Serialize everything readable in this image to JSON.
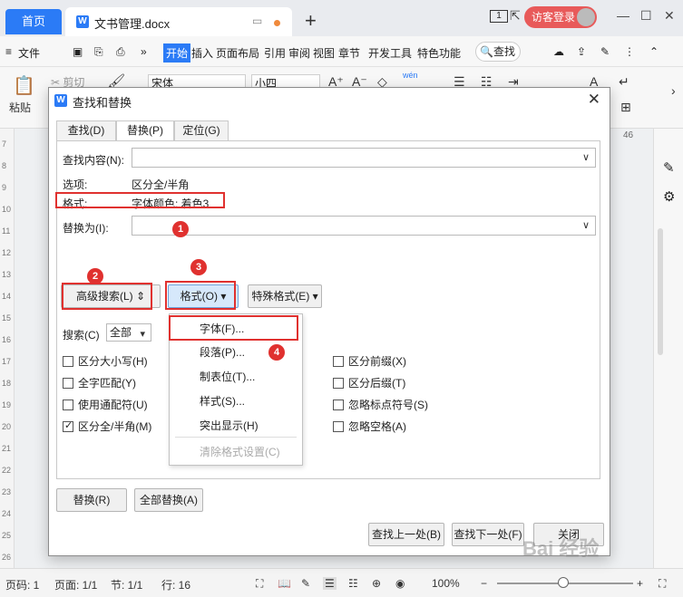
{
  "tabs": {
    "home": "首页",
    "doc": "文书管理.docx"
  },
  "titlebar": {
    "page_count": "1",
    "login": "访客登录"
  },
  "menu": {
    "file": "文件",
    "items": [
      "开始",
      "插入",
      "页面布局",
      "引用",
      "审阅",
      "视图",
      "章节",
      "开发工具",
      "特色功能"
    ],
    "search": "查找"
  },
  "ribbon": {
    "paste": "粘贴",
    "cut": "剪切",
    "font": "宋体",
    "size": "小四",
    "pinyin": "wén"
  },
  "ruler": {
    "right_num": "46",
    "left_nums": [
      "7",
      "8",
      "9",
      "10",
      "11",
      "12",
      "13",
      "14",
      "15",
      "16",
      "17",
      "18",
      "19",
      "20",
      "21",
      "22",
      "23",
      "24",
      "25",
      "26"
    ]
  },
  "dialog": {
    "title": "查找和替换",
    "tabs": [
      "查找(D)",
      "替换(P)",
      "定位(G)"
    ],
    "find_label": "查找内容(N):",
    "options_label": "选项:",
    "options_value": "区分全/半角",
    "format_label": "格式:",
    "format_value": "字体颜色: 着色3",
    "replace_label": "替换为(I):",
    "adv_search": "高级搜索(L)",
    "format_btn": "格式(O)",
    "special_btn": "特殊格式(E)",
    "search_label": "搜索(C)",
    "search_scope": "全部",
    "checks_left": [
      {
        "label": "区分大小写(H)",
        "checked": false
      },
      {
        "label": "全字匹配(Y)",
        "checked": false
      },
      {
        "label": "使用通配符(U)",
        "checked": false
      },
      {
        "label": "区分全/半角(M)",
        "checked": true
      }
    ],
    "checks_right": [
      {
        "label": "区分前缀(X)",
        "checked": false
      },
      {
        "label": "区分后缀(T)",
        "checked": false
      },
      {
        "label": "忽略标点符号(S)",
        "checked": false
      },
      {
        "label": "忽略空格(A)",
        "checked": false
      }
    ],
    "format_menu": [
      "字体(F)...",
      "段落(P)...",
      "制表位(T)...",
      "样式(S)...",
      "突出显示(H)",
      "清除格式设置(C)"
    ],
    "replace_btn": "替换(R)",
    "replace_all_btn": "全部替换(A)",
    "find_prev_btn": "查找上一处(B)",
    "find_next_btn": "查找下一处(F)",
    "close_btn": "关闭"
  },
  "badges": [
    "1",
    "2",
    "3",
    "4"
  ],
  "status": {
    "page_code": "页码: 1",
    "page": "页面: 1/1",
    "section": "节: 1/1",
    "row": "行: 16",
    "zoom": "100%"
  },
  "watermark": "Bai 经验",
  "colors": {
    "accent": "#2b7bf6",
    "annotation": "#e0312f"
  }
}
